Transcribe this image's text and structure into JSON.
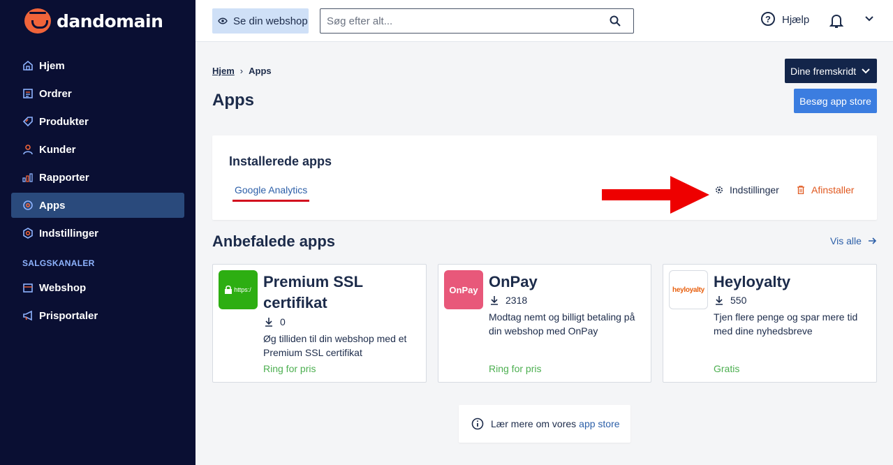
{
  "brand": {
    "name": "dandomain"
  },
  "sidebar": {
    "items": [
      {
        "label": "Hjem",
        "icon": "home-icon"
      },
      {
        "label": "Ordrer",
        "icon": "orders-icon"
      },
      {
        "label": "Produkter",
        "icon": "tag-icon"
      },
      {
        "label": "Kunder",
        "icon": "person-icon"
      },
      {
        "label": "Rapporter",
        "icon": "chart-icon"
      },
      {
        "label": "Apps",
        "icon": "apps-icon",
        "active": true
      },
      {
        "label": "Indstillinger",
        "icon": "gear-icon"
      }
    ],
    "section_label": "SALGSKANALER",
    "channels": [
      {
        "label": "Webshop",
        "icon": "shop-icon"
      },
      {
        "label": "Prisportaler",
        "icon": "megaphone-icon"
      }
    ]
  },
  "topbar": {
    "see_shop": "Se din webshop",
    "search_placeholder": "Søg efter alt...",
    "help": "Hjælp"
  },
  "breadcrumb": {
    "home": "Hjem",
    "current": "Apps"
  },
  "page": {
    "title": "Apps",
    "progress_button": "Dine fremskridt",
    "appstore_button": "Besøg app store"
  },
  "installed": {
    "title": "Installerede apps",
    "tab": "Google Analytics",
    "settings": "Indstillinger",
    "uninstall": "Afinstaller"
  },
  "recommended": {
    "title": "Anbefalede apps",
    "see_all": "Vis alle",
    "apps": [
      {
        "name_line1": "Premium SSL",
        "name_line2": "certifikat",
        "logo_text": "https:/",
        "downloads": "0",
        "desc_line1": "Øg tilliden til din webshop med et",
        "desc_line2": "Premium SSL certifikat",
        "price": "Ring for pris"
      },
      {
        "name_line1": "OnPay",
        "logo_text": "OnPay",
        "downloads": "2318",
        "desc_line1": "Modtag nemt og billigt betaling på",
        "desc_line2": "din webshop med OnPay",
        "price": "Ring for pris"
      },
      {
        "name_line1": "Heyloyalty",
        "logo_text": "heyloyalty",
        "downloads": "550",
        "desc_line1": "Tjen flere penge og spar mere tid",
        "desc_line2": "med dine nyhedsbreve",
        "price": "Gratis"
      }
    ]
  },
  "info": {
    "text": "Lær mere om vores",
    "link": "app store"
  },
  "colors": {
    "sidebar_bg": "#0a0f33",
    "active_bg": "#2a4a7c",
    "primary": "#3b7de0",
    "accent_orange": "#f0643a",
    "danger": "#e0581f",
    "success": "#4caf50",
    "arrow_red": "#ee0000"
  }
}
